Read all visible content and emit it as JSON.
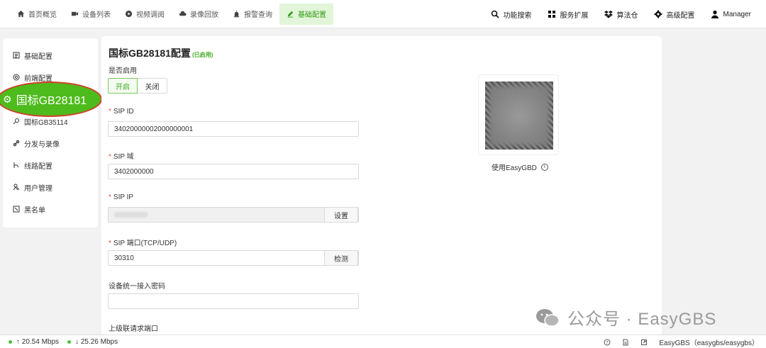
{
  "nav": {
    "items": [
      {
        "label": "首页概览",
        "icon": "home-icon"
      },
      {
        "label": "设备列表",
        "icon": "camera-icon"
      },
      {
        "label": "视频调阅",
        "icon": "play-icon"
      },
      {
        "label": "录像回放",
        "icon": "cloud-icon"
      },
      {
        "label": "报警查询",
        "icon": "alarm-icon"
      },
      {
        "label": "基础配置",
        "icon": "edit-icon",
        "active": true
      }
    ],
    "right": [
      {
        "label": "功能搜索",
        "icon": "search-icon"
      },
      {
        "label": "服务扩展",
        "icon": "grid-icon"
      },
      {
        "label": "算法仓",
        "icon": "dropbox-icon"
      },
      {
        "label": "高级配置",
        "icon": "gear-icon"
      },
      {
        "label": "Manager",
        "icon": "user-icon"
      }
    ]
  },
  "sidebar": {
    "items": [
      {
        "label": "基础配置",
        "icon": "list-icon"
      },
      {
        "label": "前端配置",
        "icon": "target-icon"
      },
      {
        "label": "国标GB35114",
        "icon": "key-icon"
      },
      {
        "label": "分发与录像",
        "icon": "link-icon"
      },
      {
        "label": "线路配置",
        "icon": "route-icon"
      },
      {
        "label": "用户管理",
        "icon": "users-icon"
      },
      {
        "label": "黑名单",
        "icon": "blacklist-icon"
      }
    ],
    "highlight": {
      "label": "国标GB28181",
      "icon": "gear-icon"
    }
  },
  "main": {
    "title": "国标GB28181配置",
    "status_tag": "(已启用)",
    "enable_label": "是否启用",
    "enable_on": "开启",
    "enable_off": "关闭",
    "sip_id_label": "SIP ID",
    "sip_id_value": "34020000002000000001",
    "sip_domain_label": "SIP 域",
    "sip_domain_value": "3402000000",
    "sip_ip_label": "SIP IP",
    "sip_ip_button": "设置",
    "sip_port_label": "SIP 端口(TCP/UDP)",
    "sip_port_value": "30310",
    "sip_port_button": "检测",
    "password_label": "设备统一接入密码",
    "password_value": "",
    "upstream_port_label": "上级联请求端口",
    "qr_caption": "使用EasyGBD",
    "info_icon": "i"
  },
  "watermark": {
    "text": "公众号 · EasyGBS"
  },
  "status": {
    "up": "↑ 20.54 Mbps",
    "down": "↓ 25.26 Mbps",
    "right_text": "EasyGBS（easygbs/easygbs）"
  },
  "colors": {
    "accent": "#4ebb1c",
    "active_bg": "#e2f5d8",
    "highlight_border": "#d0402a"
  }
}
